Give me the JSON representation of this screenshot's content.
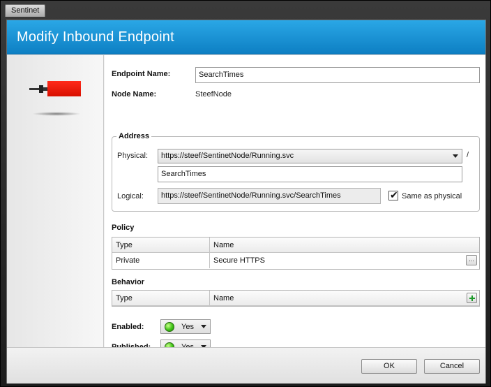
{
  "app": {
    "title": "Sentinet"
  },
  "dialog": {
    "title": "Modify Inbound Endpoint"
  },
  "endpoint": {
    "name_label": "Endpoint Name:",
    "name_value": "SearchTimes",
    "node_label": "Node Name:",
    "node_value": "SteefNode"
  },
  "address": {
    "group_title": "Address",
    "physical_label": "Physical:",
    "physical_value": "https://steef/SentinetNode/Running.svc",
    "separator": "/",
    "path_value": "SearchTimes",
    "logical_label": "Logical:",
    "logical_value": "https://steef/SentinetNode/Running.svc/SearchTimes",
    "same_as_physical_label": "Same as physical",
    "same_as_physical_checked": true
  },
  "policy": {
    "title": "Policy",
    "columns": [
      "Type",
      "Name"
    ],
    "rows": [
      {
        "type": "Private",
        "name": "Secure HTTPS"
      }
    ],
    "browse_label": "..."
  },
  "behavior": {
    "title": "Behavior",
    "columns": [
      "Type",
      "Name"
    ],
    "rows": []
  },
  "enabled": {
    "label": "Enabled:",
    "value": "Yes",
    "status_color": "#3ec316"
  },
  "published": {
    "label": "Published:",
    "value": "Yes",
    "status_color": "#3ec316"
  },
  "buttons": {
    "ok": "OK",
    "cancel": "Cancel"
  },
  "icons": {
    "endpoint": "endpoint-plug-icon",
    "status": "green-status-icon",
    "dropdown": "chevron-down-icon",
    "add": "plus-icon",
    "check": "checkmark-icon"
  },
  "colors": {
    "header": "#1a95d8",
    "plug": "#ff2a1a"
  }
}
